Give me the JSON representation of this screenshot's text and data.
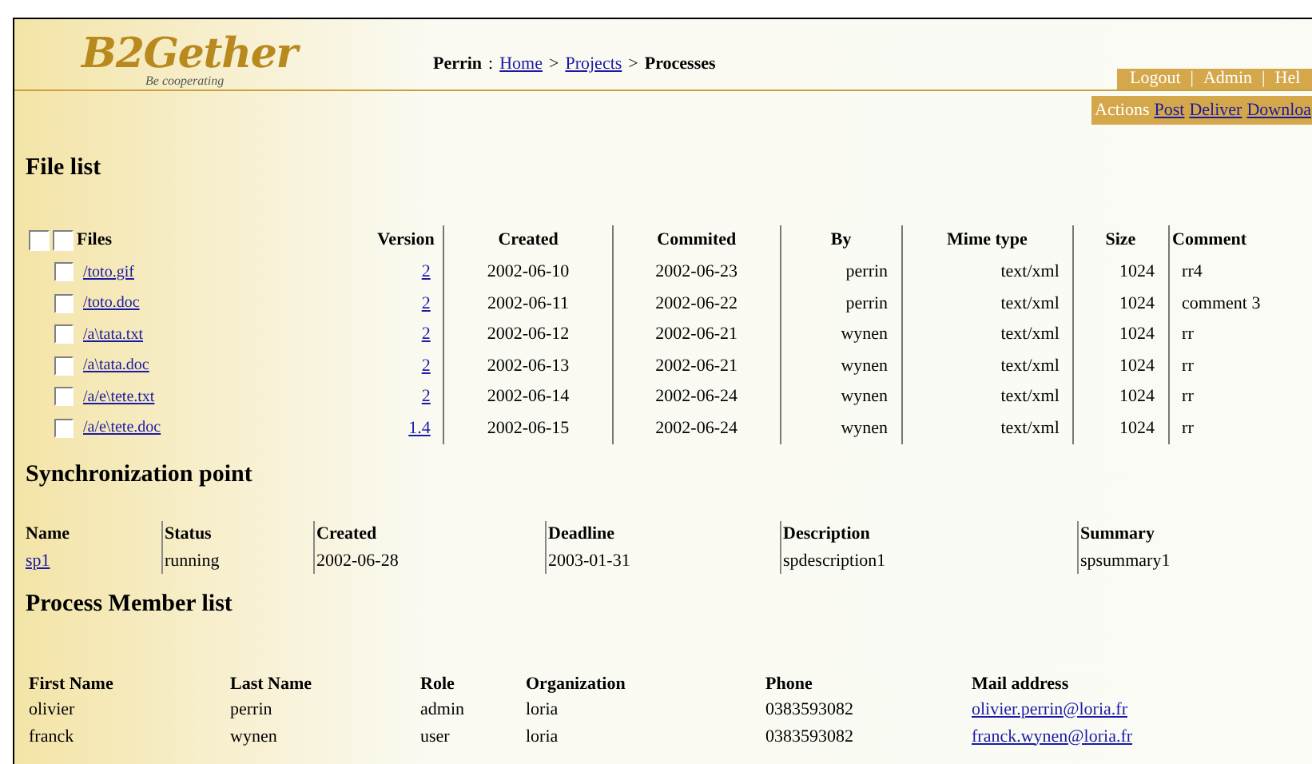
{
  "logo": {
    "text": "B2Gether",
    "tagline": "Be cooperating"
  },
  "breadcrumb": {
    "user": "Perrin",
    "separator": ":",
    "items": [
      {
        "label": "Home",
        "kind": "link"
      },
      {
        "label": "Projects",
        "kind": "link"
      },
      {
        "label": "Processes",
        "kind": "current"
      }
    ],
    "arrow": ">"
  },
  "top_menu": {
    "separator": "|",
    "items": [
      "Logout",
      "Admin",
      "Hel"
    ]
  },
  "actions": {
    "label": "Actions",
    "links": [
      "Post",
      "Deliver",
      "Downloa"
    ]
  },
  "file_list": {
    "title": "File list",
    "header_checkboxes": [
      {
        "checked": false
      },
      {
        "checked": false
      }
    ],
    "columns": [
      "Files",
      "Version",
      "Created",
      "Commited",
      "By",
      "Mime type",
      "Size",
      "Comment"
    ],
    "rows": [
      {
        "checked": false,
        "cells": [
          "/toto.gif",
          "2",
          "2002-06-10",
          "2002-06-23",
          "perrin",
          "text/xml",
          "1024",
          "rr4"
        ]
      },
      {
        "checked": false,
        "cells": [
          "/toto.doc",
          "2",
          "2002-06-11",
          "2002-06-22",
          "perrin",
          "text/xml",
          "1024",
          "comment 3"
        ]
      },
      {
        "checked": false,
        "cells": [
          "/a\\tata.txt",
          "2",
          "2002-06-12",
          "2002-06-21",
          "wynen",
          "text/xml",
          "1024",
          "rr"
        ]
      },
      {
        "checked": false,
        "cells": [
          "/a\\tata.doc",
          "2",
          "2002-06-13",
          "2002-06-21",
          "wynen",
          "text/xml",
          "1024",
          "rr"
        ]
      },
      {
        "checked": false,
        "cells": [
          "/a/e\\tete.txt",
          "2",
          "2002-06-14",
          "2002-06-24",
          "wynen",
          "text/xml",
          "1024",
          "rr"
        ]
      },
      {
        "checked": false,
        "cells": [
          "/a/e\\tete.doc",
          "1.4",
          "2002-06-15",
          "2002-06-24",
          "wynen",
          "text/xml",
          "1024",
          "rr"
        ]
      }
    ]
  },
  "sync": {
    "title": "Synchronization point",
    "columns": [
      "Name",
      "Status",
      "Created",
      "Deadline",
      "Description",
      "Summary"
    ],
    "rows": [
      [
        "sp1",
        "running",
        "2002-06-28",
        "2003-01-31",
        "spdescription1",
        "spsummary1"
      ]
    ]
  },
  "members": {
    "title": "Process Member list",
    "columns": [
      "First Name",
      "Last Name",
      "Role",
      "Organization",
      "Phone",
      "Mail address"
    ],
    "rows": [
      [
        "olivier",
        "perrin",
        "admin",
        "loria",
        "0383593082",
        "olivier.perrin@loria.fr"
      ],
      [
        "franck",
        "wynen",
        "user",
        "loria",
        "0383593082",
        "franck.wynen@loria.fr"
      ]
    ]
  }
}
